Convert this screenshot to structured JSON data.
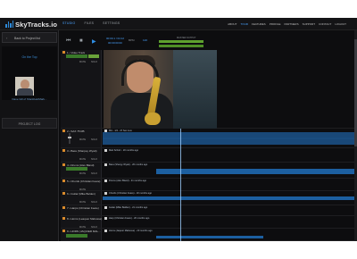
{
  "app": {
    "logo_text": "SkyTracks.io",
    "nav": [
      "STUDIO",
      "FILES",
      "SETTINGS"
    ],
    "right_nav": [
      "ABOUT",
      "TOUR",
      "FEATURES",
      "PROFILE",
      "PARTNERS",
      "SUPPORT",
      "CONTACT",
      "LOGOUT"
    ],
    "accent_color": "#2f8fe6"
  },
  "sidebar": {
    "back_label": "Back to Project list",
    "artist_name": "On the Top",
    "artist_sub": "Dave Gill of Sharkbait/Mark...",
    "project_tab": "PROJECT LOG"
  },
  "transport": {
    "time_main": "00:00.1 / 04:12",
    "time_sub": "00:00:00:00",
    "bpm_label": "BPM",
    "bpm_value": "120",
    "master_label": "MASTER OUTPUT"
  },
  "tracks": [
    {
      "num": "1",
      "name": "1 • Video Track",
      "mute": "MUTE",
      "solo": "SOLO",
      "clip": "",
      "color": "#d98a2b"
    },
    {
      "num": "2",
      "name": "2 • SAX 75 RB",
      "mute": "MUTE",
      "solo": "SOLO",
      "clip": "Mix - 1/4 - 47 Sec Live",
      "color": "#d98a2b"
    },
    {
      "num": "3",
      "name": "3 • Bass (Sharpey Wyatt)",
      "mute": "MUTE",
      "solo": "SOLO",
      "clip": "Matt Scholz - 20 months ago",
      "color": "#d98a2b"
    },
    {
      "num": "4",
      "name": "4 • Drums (Alex Bland)",
      "mute": "MUTE",
      "solo": "SOLO",
      "clip": "Bass (Sharpy Wyatt) - 20 months ago",
      "color": "#d98a2b"
    },
    {
      "num": "5",
      "name": "5 • Chords (Christian Feare)",
      "mute": "MUTE",
      "solo": "SOLO",
      "clip": "Drums (Alex Bland) - 21 months ago",
      "color": "#d98a2b"
    },
    {
      "num": "6",
      "name": "6 • Guitar (Mike Belden)",
      "mute": "MUTE",
      "solo": "SOLO",
      "clip": "Chords (Christian Feare) - 20 months ago",
      "color": "#d98a2b"
    },
    {
      "num": "7",
      "name": "7 • Harps (Christian Feare)",
      "mute": "MUTE",
      "solo": "SOLO",
      "clip": "Guitar (Mike Belden) - 21 months ago",
      "color": "#d98a2b"
    },
    {
      "num": "8",
      "name": "8 • Horns (Leaquer Mabusse)",
      "mute": "MUTE",
      "solo": "SOLO",
      "clip": "Harp (Christian Feare) - 20 months ago",
      "color": "#d98a2b"
    },
    {
      "num": "9",
      "name": "9 • HORN (JAQUIER MAL...",
      "mute": "MUTE",
      "solo": "SOLO",
      "clip": "Horns (Jaquier Mabusse) - 20 months ago",
      "color": "#d98a2b"
    }
  ]
}
